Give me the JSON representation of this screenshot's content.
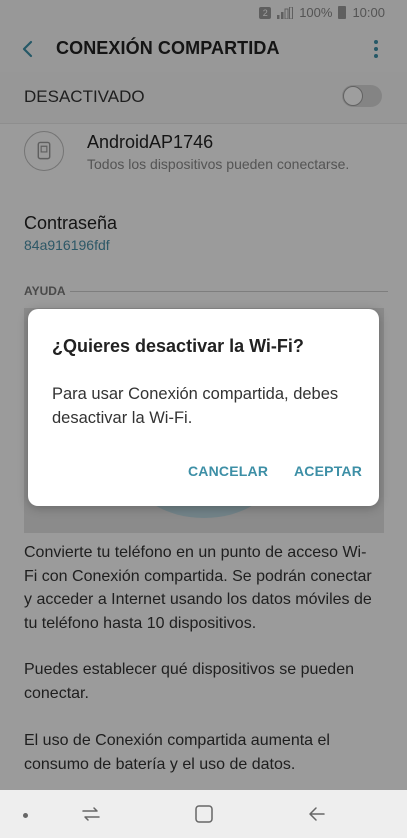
{
  "status_bar": {
    "battery": "100%",
    "time": "10:00",
    "notification_icon": "notification-icon",
    "signal_icon": "signal-icon",
    "battery_icon": "battery-icon"
  },
  "app_bar": {
    "title": "CONEXIÓN COMPARTIDA",
    "back_icon": "back-arrow-icon",
    "menu_icon": "more-vert-icon"
  },
  "master_switch": {
    "label": "DESACTIVADO",
    "checked": false
  },
  "hotspot": {
    "name": "AndroidAP1746",
    "subtitle": "Todos los dispositivos pueden conectarse.",
    "icon": "device-share-icon"
  },
  "password": {
    "label": "Contraseña",
    "value": "84a916196fdf"
  },
  "help": {
    "header": "AYUDA",
    "paragraphs": [
      "Convierte tu teléfono en un punto de acceso Wi-Fi con Conexión compartida. Se podrán conectar y acceder a Internet usando los datos móviles de tu teléfono hasta 10 dispositivos.",
      "Puedes establecer qué dispositivos se pueden conectar.",
      "El uso de Conexión compartida aumenta el consumo de batería y el uso de datos."
    ]
  },
  "dialog": {
    "title": "¿Quieres desactivar la Wi-Fi?",
    "body": "Para usar Conexión compartida, debes desactivar la Wi-Fi.",
    "cancel_label": "CANCELAR",
    "accept_label": "ACEPTAR"
  },
  "nav_bar": {
    "icons": [
      "nav-dot-icon",
      "recent-apps-icon",
      "home-icon",
      "back-icon"
    ]
  },
  "colors": {
    "accent": "#3d8fa6",
    "password_color": "#4a8ea6"
  }
}
